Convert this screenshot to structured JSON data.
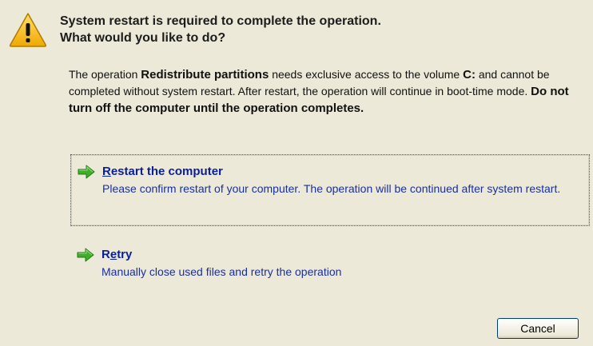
{
  "header": {
    "icon": "warning-icon",
    "title_line1": "System restart is required to complete the operation.",
    "title_line2": "What would you like to do?"
  },
  "description": {
    "p1": "The operation ",
    "op_name": "Redistribute partitions",
    "p2": " needs exclusive access to the volume ",
    "volume": "C:",
    "p3": " and cannot be completed without system restart. After restart, the operation will continue in boot-time mode. ",
    "warning": "Do not turn off the computer until the operation completes."
  },
  "options": [
    {
      "icon": "green-arrow-icon",
      "hotkey": "R",
      "title_rest": "estart the computer",
      "subtitle": "Please confirm restart of your computer. The operation will be continued after system restart.",
      "selected": true
    },
    {
      "icon": "green-arrow-icon",
      "title_pre": "R",
      "hotkey": "e",
      "title_rest": "try",
      "subtitle": "Manually close used files and retry the operation",
      "selected": false
    }
  ],
  "buttons": {
    "cancel": "Cancel"
  },
  "colors": {
    "background": "#ece9d8",
    "option_title": "#0a1f96",
    "option_text": "#1a2f9e",
    "arrow_green": "#3fae2a",
    "warning_yellow": "#f5c518"
  }
}
